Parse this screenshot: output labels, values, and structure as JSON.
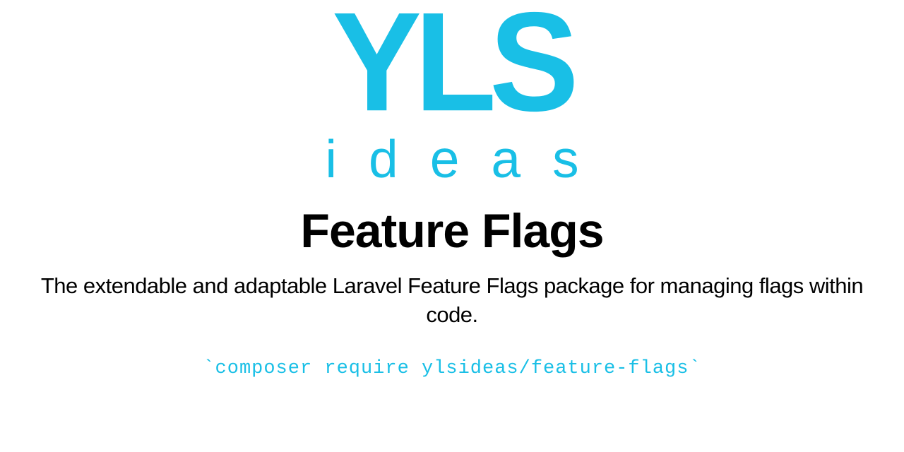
{
  "brand": {
    "accent_color": "#19BFE6",
    "logo_top": "YLS",
    "logo_bottom": "ideas"
  },
  "title": "Feature Flags",
  "subtitle": "The extendable and adaptable Laravel Feature Flags package for managing flags within code.",
  "command": "`composer require ylsideas/feature-flags`"
}
